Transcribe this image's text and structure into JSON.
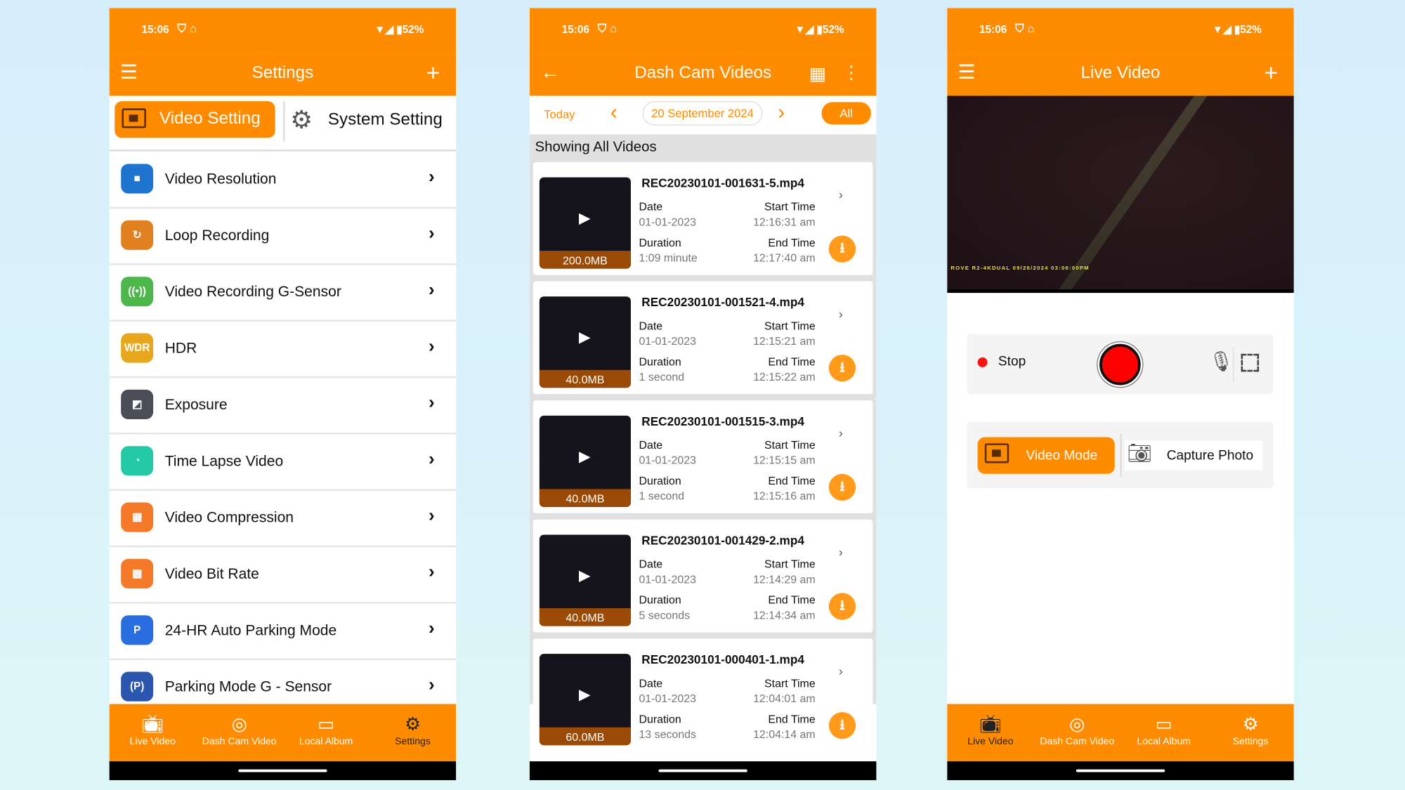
{
  "status": {
    "time": "15:06",
    "battery": "52%"
  },
  "colors": {
    "accent": "#ff8c00",
    "record": "#ff0000"
  },
  "nav": {
    "items": [
      {
        "label": "Live Video",
        "icon": "tv-play-icon"
      },
      {
        "label": "Dash Cam Video",
        "icon": "camera-icon"
      },
      {
        "label": "Local Album",
        "icon": "album-icon"
      },
      {
        "label": "Settings",
        "icon": "gear-icon"
      }
    ]
  },
  "settings": {
    "title": "Settings",
    "tab_video": "Video Setting",
    "tab_system": "System Setting",
    "items": [
      {
        "label": "Video Resolution",
        "icon": "video-camera-icon",
        "color": "#1f74d0",
        "glyph": "■"
      },
      {
        "label": "Loop Recording",
        "icon": "loop-camera-icon",
        "color": "#e08020",
        "glyph": "↻"
      },
      {
        "label": "Video Recording G-Sensor",
        "icon": "sensor-waves-icon",
        "color": "#4cb84c",
        "glyph": "((•))"
      },
      {
        "label": "HDR",
        "icon": "wdr-icon",
        "color": "#e8a81e",
        "glyph": "WDR"
      },
      {
        "label": "Exposure",
        "icon": "exposure-icon",
        "color": "#4a4d57",
        "glyph": "◩"
      },
      {
        "label": "Time Lapse Video",
        "icon": "speedometer-icon",
        "color": "#22c9a4",
        "glyph": "◔"
      },
      {
        "label": "Video Compression",
        "icon": "compression-icon",
        "color": "#f47a2a",
        "glyph": "▦"
      },
      {
        "label": "Video Bit Rate",
        "icon": "bitrate-icon",
        "color": "#f47a2a",
        "glyph": "▦"
      },
      {
        "label": "24-HR Auto Parking Mode",
        "icon": "parking-icon",
        "color": "#2a6de0",
        "glyph": "P"
      },
      {
        "label": "Parking Mode G - Sensor",
        "icon": "parking-sensor-icon",
        "color": "#2a56b0",
        "glyph": "(P)"
      }
    ]
  },
  "videos": {
    "title": "Dash Cam Videos",
    "today": "Today",
    "date": "20 September 2024",
    "all": "All",
    "showing": "Showing All  Videos",
    "labels": {
      "date": "Date",
      "start": "Start Time",
      "duration": "Duration",
      "end": "End Time"
    },
    "items": [
      {
        "name": "REC20230101-001631-5.mp4",
        "size": "200.0MB",
        "date": "01-01-2023",
        "start": "12:16:31 am",
        "duration": "1:09 minute",
        "end": "12:17:40 am"
      },
      {
        "name": "REC20230101-001521-4.mp4",
        "size": "40.0MB",
        "date": "01-01-2023",
        "start": "12:15:21 am",
        "duration": "1 second",
        "end": "12:15:22 am"
      },
      {
        "name": "REC20230101-001515-3.mp4",
        "size": "40.0MB",
        "date": "01-01-2023",
        "start": "12:15:15 am",
        "duration": "1 second",
        "end": "12:15:16 am"
      },
      {
        "name": "REC20230101-001429-2.mp4",
        "size": "40.0MB",
        "date": "01-01-2023",
        "start": "12:14:29 am",
        "duration": "5 seconds",
        "end": "12:14:34 am"
      },
      {
        "name": "REC20230101-000401-1.mp4",
        "size": "60.0MB",
        "date": "01-01-2023",
        "start": "12:04:01 am",
        "duration": "13 seconds",
        "end": "12:04:14 am"
      }
    ]
  },
  "live": {
    "title": "Live Video",
    "osd": "ROVE R2-4KDUAL  09/26/2024  03:06:00PM",
    "stop": "Stop",
    "video_mode": "Video Mode",
    "capture_photo": "Capture Photo"
  }
}
